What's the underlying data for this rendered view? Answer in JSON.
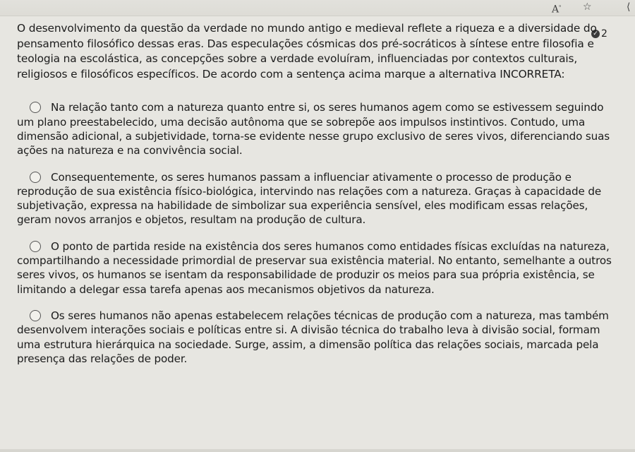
{
  "toolbar": {
    "read_aloud_icon": "read-aloud-icon",
    "favorite_icon": "star-icon",
    "more_icon": "more-icon"
  },
  "question": {
    "attempt_count": "2",
    "text": "O desenvolvimento da questão da verdade no mundo antigo e medieval reflete a riqueza e a diversidade do pensamento filosófico dessas eras. Das especulações cósmicas dos pré-socráticos à síntese entre filosofia e teologia na escolástica, as concepções sobre a verdade evoluíram, influenciadas por contextos culturais, religiosos e filosóficos específicos. De acordo com a sentença acima marque a alternativa INCORRETA:"
  },
  "options": [
    {
      "text": "Na relação tanto com a natureza quanto entre si, os seres humanos agem como se estivessem seguindo um plano preestabelecido, uma decisão autônoma que se sobrepõe aos impulsos instintivos. Contudo, uma dimensão adicional, a subjetividade, torna-se evidente nesse grupo exclusivo de seres vivos, diferenciando suas ações na natureza e na convivência social."
    },
    {
      "text": "Consequentemente, os seres humanos passam a influenciar ativamente o processo de produção e reprodução de sua existência físico-biológica, intervindo nas relações com a natureza. Graças à capacidade de subjetivação, expressa na habilidade de simbolizar sua experiência sensível, eles modificam essas relações, geram novos arranjos e objetos, resultam na produção de cultura."
    },
    {
      "text": "O ponto de partida reside na existência dos seres humanos como entidades físicas excluídas na natureza, compartilhando a necessidade primordial de preservar sua existência material. No entanto, semelhante a outros seres vivos, os humanos se isentam da responsabilidade de produzir os meios para sua própria existência, se limitando a delegar essa tarefa apenas aos mecanismos objetivos da natureza."
    },
    {
      "text": "Os seres humanos não apenas estabelecem relações técnicas de produção com a natureza, mas também desenvolvem interações sociais e políticas entre si. A divisão técnica do trabalho leva à divisão social, formam uma estrutura hierárquica na sociedade. Surge, assim, a dimensão política das relações sociais, marcada pela presença das relações de poder."
    }
  ]
}
